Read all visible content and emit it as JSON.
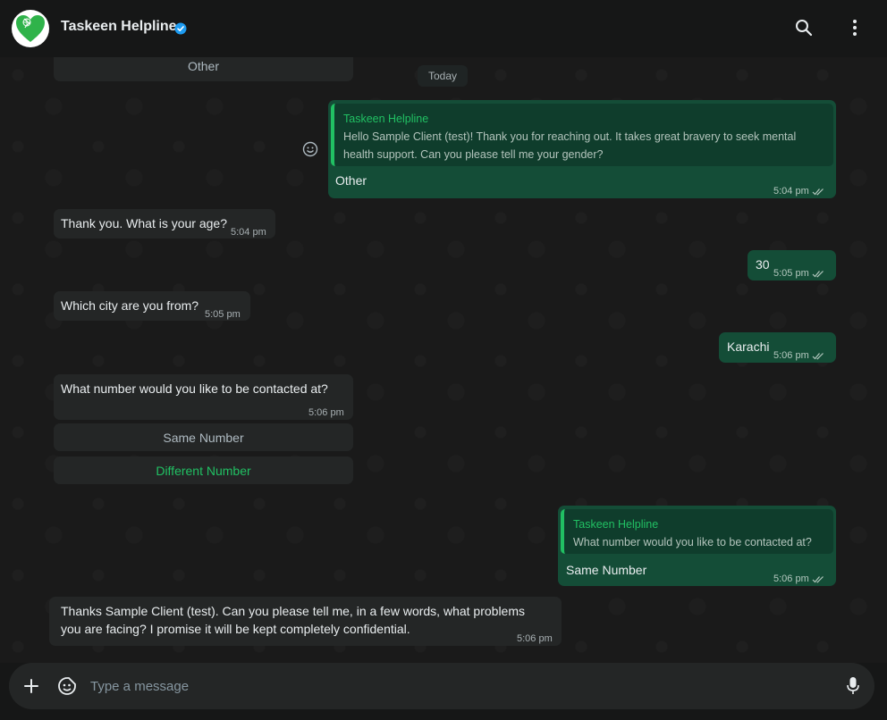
{
  "header": {
    "title": "Taskeen Helpline",
    "icons": [
      "heart-logo-icon",
      "verified-badge-icon",
      "search-icon",
      "more-vert-icon"
    ]
  },
  "chat": {
    "date_label": "Today",
    "partial_option": "Other",
    "messages": [
      {
        "dir": "out",
        "quote_name": "Taskeen Helpline",
        "quote_text_1": "Hello Sample Client (test)! Thank you for reaching out. It takes great bravery to seek mental",
        "quote_text_2": "health support. Can you please tell me your gender?",
        "text": "Other",
        "time": "5:04 pm"
      },
      {
        "dir": "in",
        "text": "Thank you. What is your age?",
        "time": "5:04 pm"
      },
      {
        "dir": "out",
        "text": "30",
        "time": "5:05 pm"
      },
      {
        "dir": "in",
        "text": "Which city are you from?",
        "time": "5:05 pm"
      },
      {
        "dir": "out",
        "text": "Karachi",
        "time": "5:06 pm"
      },
      {
        "dir": "in",
        "text": "What number would you like to be contacted at?",
        "time": "5:06 pm",
        "options": [
          "Same Number",
          "Different Number"
        ]
      },
      {
        "dir": "out",
        "quote_name": "Taskeen Helpline",
        "quote_text_1": "What number would you like to be contacted at?",
        "text": "Same Number",
        "time": "5:06 pm"
      },
      {
        "dir": "in",
        "text_1": "Thanks Sample Client (test). Can you please tell me, in a few words, what problems",
        "text_2": "you are facing? I promise it will be kept completely confidential.",
        "time": "5:06 pm"
      }
    ]
  },
  "footer": {
    "placeholder": "Type a message"
  },
  "colors": {
    "accent_green": "#21c063",
    "outgoing_bubble": "#144d37",
    "incoming_bubble": "#242626",
    "header_bg": "#161717",
    "verified_blue": "#1d9bf0"
  }
}
